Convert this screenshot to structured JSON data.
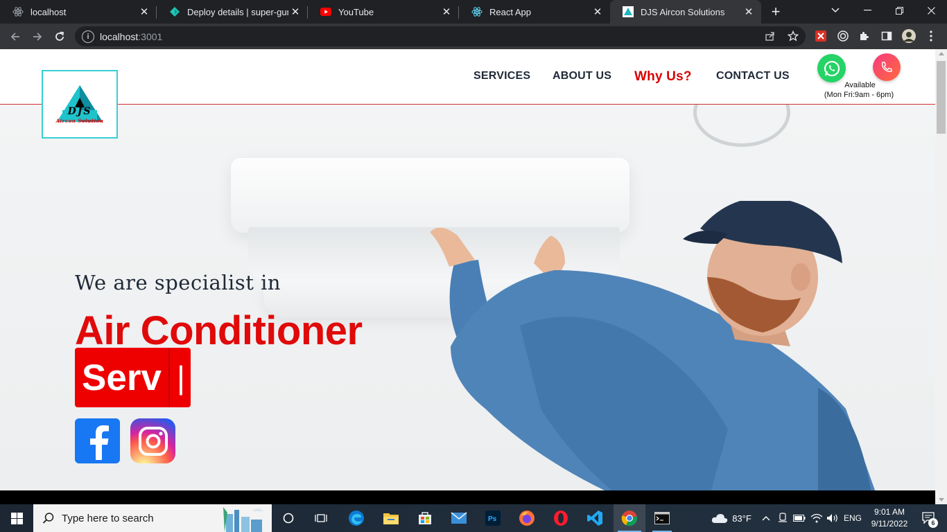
{
  "browser": {
    "tabs": [
      {
        "title": "localhost",
        "icon": "react-icon",
        "active": false
      },
      {
        "title": "Deploy details | super-gumdr",
        "icon": "netlify-icon",
        "active": false
      },
      {
        "title": "YouTube",
        "icon": "youtube-icon",
        "active": false
      },
      {
        "title": "React App",
        "icon": "react-icon",
        "active": false
      },
      {
        "title": "DJS Aircon Solutions",
        "icon": "site-favicon",
        "active": true
      }
    ],
    "new_tab": "+",
    "url_host": "localhost",
    "url_port": ":3001"
  },
  "site": {
    "logo_letters": "DJS",
    "logo_caption": "Aircon Solution",
    "nav": {
      "services": "SERVICES",
      "about": "ABOUT US",
      "why": "Why Us?",
      "contact": "CONTACT US"
    },
    "availability": {
      "line1": "Available",
      "line2": "(Mon Fri:9am - 6pm)"
    },
    "hero": {
      "tagline": "We are specialist in",
      "headline": "Air Conditioner",
      "typed_text": "Serv",
      "cursor": "|"
    },
    "colors": {
      "accent": "#e00a0a",
      "whatsapp": "#25d366",
      "logo_border": "#36cfd6"
    }
  },
  "taskbar": {
    "search_placeholder": "Type here to search",
    "weather": "83°F",
    "language": "ENG",
    "time": "9:01 AM",
    "date": "9/11/2022",
    "notifications": "6"
  }
}
